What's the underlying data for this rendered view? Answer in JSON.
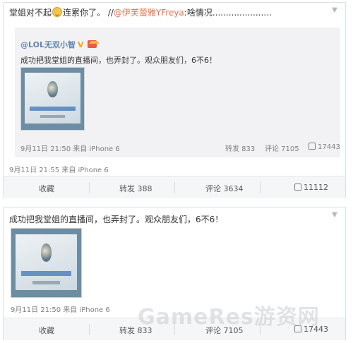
{
  "post1": {
    "text_prefix": "堂姐对不起",
    "text_mid": "连累你了。 //",
    "mention": "@伊芙蕾雅YFreya",
    "text_suffix": ":啥情况......................",
    "repost": {
      "author": "@LOL无双小智",
      "text": "成功把我堂姐的直播间，也弄封了。观众朋友们，6不6！",
      "meta": "9月11日 21:50 来自 iPhone 6",
      "forward_label": "转发 833",
      "comment_label": "评论 7105",
      "like_count": "17443"
    },
    "meta": "9月11日 21:55 来自 iPhone 6",
    "actions": {
      "favorite": "收藏",
      "forward": "转发 388",
      "comment": "评论 3634",
      "like": "11112"
    }
  },
  "post2": {
    "text": "成功把我堂姐的直播间，也弄封了。观众朋友们，6不6！",
    "meta": "9月11日 21:50 来自 iPhone 6",
    "actions": {
      "favorite": "收藏",
      "forward": "转发 833",
      "comment": "评论 7105",
      "like": "17443"
    }
  },
  "watermark": "GameRes游资网",
  "icons": {
    "chevron": "chevron-down-icon",
    "emoji": "emoji-icon",
    "verified": "verified-v-icon",
    "crown": "crown-badge-icon",
    "like": "thumbs-up-icon"
  },
  "colors": {
    "link": "#5d86b3",
    "mention": "#eb7350",
    "meta": "#808080",
    "repost_bg": "#f2f2f5"
  }
}
